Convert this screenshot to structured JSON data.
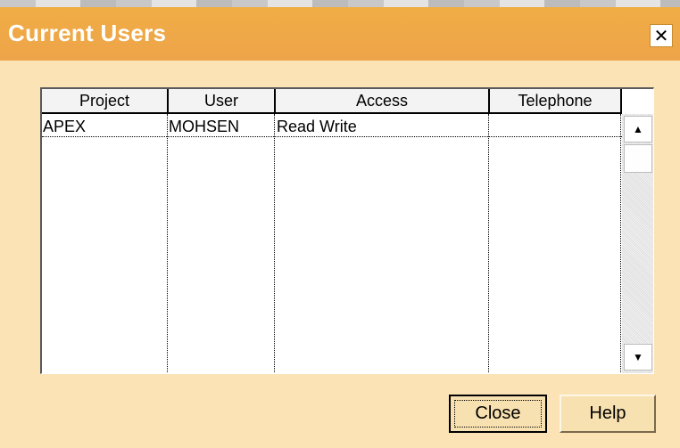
{
  "dialog": {
    "title": "Current Users",
    "close_icon": "close-icon"
  },
  "table": {
    "columns": [
      "Project",
      "User",
      "Access",
      "Telephone"
    ],
    "rows": [
      {
        "project": "APEX",
        "user": "MOHSEN",
        "access": "Read Write",
        "telephone": ""
      }
    ]
  },
  "scrollbar": {
    "up_icon": "arrow-up-icon",
    "down_icon": "arrow-down-icon"
  },
  "buttons": {
    "close_label": "Close",
    "help_label": "Help"
  }
}
